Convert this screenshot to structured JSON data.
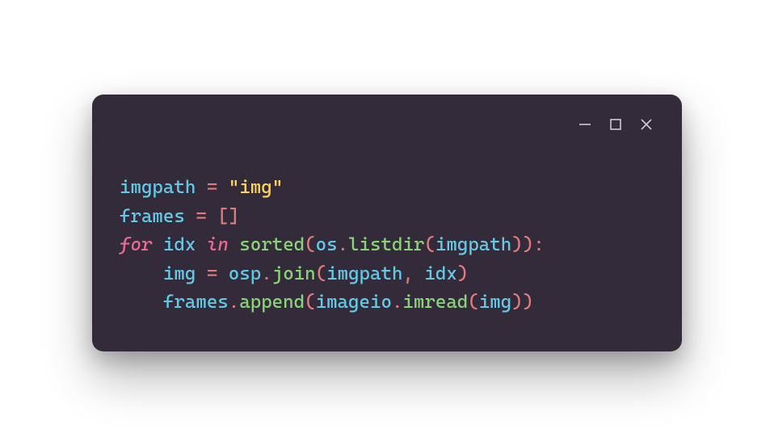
{
  "window": {
    "bg": "#332b39",
    "controls": {
      "minimize": "minimize",
      "maximize": "maximize",
      "close": "close"
    }
  },
  "code": {
    "lines": [
      {
        "tokens": [
          {
            "t": "imgpath",
            "c": "name"
          },
          {
            "t": " ",
            "c": ""
          },
          {
            "t": "=",
            "c": "op"
          },
          {
            "t": " ",
            "c": ""
          },
          {
            "t": "\"img\"",
            "c": "str"
          }
        ]
      },
      {
        "tokens": [
          {
            "t": "frames",
            "c": "name"
          },
          {
            "t": " ",
            "c": ""
          },
          {
            "t": "=",
            "c": "op"
          },
          {
            "t": " ",
            "c": ""
          },
          {
            "t": "[]",
            "c": "op"
          }
        ]
      },
      {
        "tokens": [
          {
            "t": "for",
            "c": "kw"
          },
          {
            "t": " ",
            "c": ""
          },
          {
            "t": "idx",
            "c": "name"
          },
          {
            "t": " ",
            "c": ""
          },
          {
            "t": "in",
            "c": "kw"
          },
          {
            "t": " ",
            "c": ""
          },
          {
            "t": "sorted",
            "c": "builtin"
          },
          {
            "t": "(",
            "c": "op"
          },
          {
            "t": "os",
            "c": "name"
          },
          {
            "t": ".",
            "c": "op"
          },
          {
            "t": "listdir",
            "c": "func"
          },
          {
            "t": "(",
            "c": "op"
          },
          {
            "t": "imgpath",
            "c": "name"
          },
          {
            "t": "))",
            "c": "op"
          },
          {
            "t": ":",
            "c": "op"
          }
        ]
      },
      {
        "tokens": [
          {
            "t": "    ",
            "c": ""
          },
          {
            "t": "img",
            "c": "name"
          },
          {
            "t": " ",
            "c": ""
          },
          {
            "t": "=",
            "c": "op"
          },
          {
            "t": " ",
            "c": ""
          },
          {
            "t": "osp",
            "c": "name"
          },
          {
            "t": ".",
            "c": "op"
          },
          {
            "t": "join",
            "c": "func"
          },
          {
            "t": "(",
            "c": "op"
          },
          {
            "t": "imgpath",
            "c": "name"
          },
          {
            "t": ",",
            "c": "op"
          },
          {
            "t": " ",
            "c": ""
          },
          {
            "t": "idx",
            "c": "name"
          },
          {
            "t": ")",
            "c": "op"
          }
        ]
      },
      {
        "tokens": [
          {
            "t": "    ",
            "c": ""
          },
          {
            "t": "frames",
            "c": "name"
          },
          {
            "t": ".",
            "c": "op"
          },
          {
            "t": "append",
            "c": "func"
          },
          {
            "t": "(",
            "c": "op"
          },
          {
            "t": "imageio",
            "c": "name"
          },
          {
            "t": ".",
            "c": "op"
          },
          {
            "t": "imread",
            "c": "func"
          },
          {
            "t": "(",
            "c": "op"
          },
          {
            "t": "img",
            "c": "name"
          },
          {
            "t": "))",
            "c": "op"
          }
        ]
      }
    ]
  }
}
